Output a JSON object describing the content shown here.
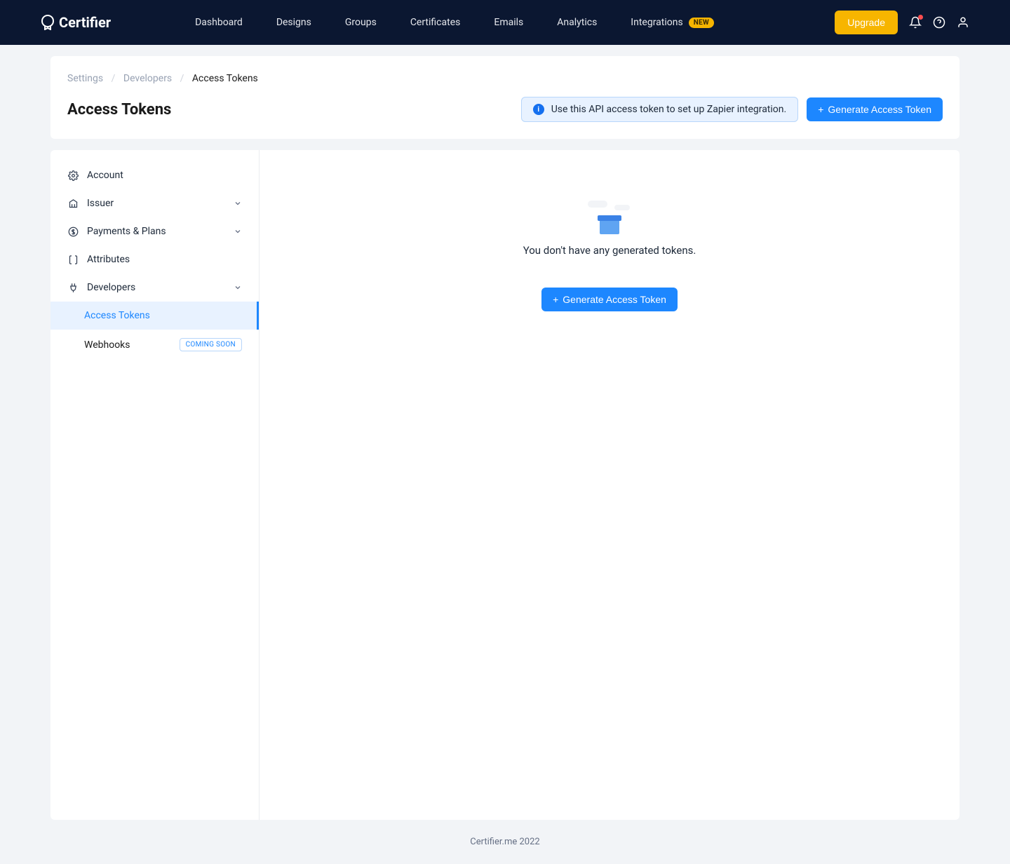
{
  "brand": "Certifier",
  "nav": {
    "items": [
      "Dashboard",
      "Designs",
      "Groups",
      "Certificates",
      "Emails",
      "Analytics",
      "Integrations"
    ],
    "integrations_badge": "NEW",
    "upgrade": "Upgrade"
  },
  "breadcrumb": {
    "settings": "Settings",
    "developers": "Developers",
    "current": "Access Tokens"
  },
  "page_title": "Access Tokens",
  "info_banner": "Use this API access token to set up Zapier integration.",
  "btn_generate": "Generate Access Token",
  "sidebar": {
    "account": "Account",
    "issuer": "Issuer",
    "payments": "Payments & Plans",
    "attributes": "Attributes",
    "developers": "Developers",
    "access_tokens": "Access Tokens",
    "webhooks": "Webhooks",
    "coming_soon": "COMING SOON"
  },
  "empty_state": "You don't have any generated tokens.",
  "footer": "Certifier.me 2022"
}
